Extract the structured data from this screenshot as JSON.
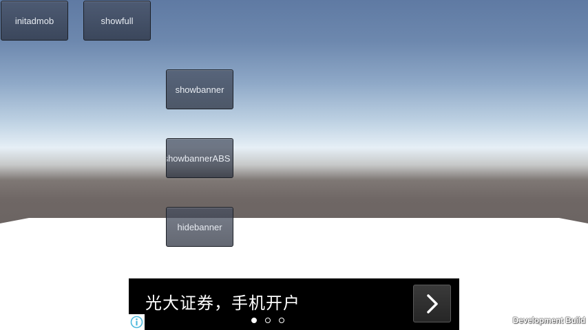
{
  "buttons": {
    "initadmob": "initadmob",
    "showfull": "showfull",
    "showbanner": "showbanner",
    "showbannerABS": "showbannerABS",
    "hidebanner": "hidebanner"
  },
  "ad": {
    "headline": "光大证券，手机开户",
    "arrow_icon": "chevron-right-icon",
    "info_icon": "info-icon",
    "pager": {
      "total": 3,
      "active": 1
    }
  },
  "overlay": {
    "dev_build": "Development Build"
  },
  "colors": {
    "sky_top": "#5f7aa3",
    "horizon": "#e6eff6",
    "ground_far": "#6f6765",
    "floor": "#ffffff",
    "ad_background": "#000000",
    "info_icon": "#4bb8dc"
  }
}
